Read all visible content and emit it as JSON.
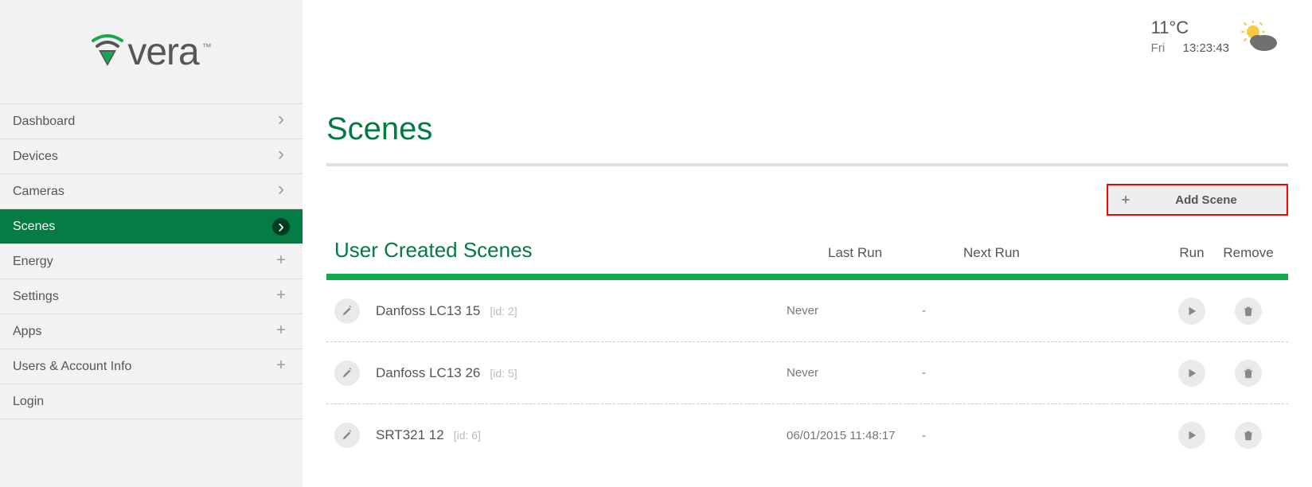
{
  "brand": {
    "name": "vera",
    "tm": "™"
  },
  "sidebar": {
    "items": [
      {
        "label": "Dashboard",
        "kind": "chev",
        "active": false
      },
      {
        "label": "Devices",
        "kind": "chev",
        "active": false
      },
      {
        "label": "Cameras",
        "kind": "chev",
        "active": false
      },
      {
        "label": "Scenes",
        "kind": "chev",
        "active": true
      },
      {
        "label": "Energy",
        "kind": "plus",
        "active": false
      },
      {
        "label": "Settings",
        "kind": "plus",
        "active": false
      },
      {
        "label": "Apps",
        "kind": "plus",
        "active": false
      },
      {
        "label": "Users & Account Info",
        "kind": "plus",
        "active": false
      },
      {
        "label": "Login",
        "kind": "none",
        "active": false
      }
    ]
  },
  "status": {
    "temp": "11°C",
    "day": "Fri",
    "time": "13:23:43"
  },
  "page": {
    "title": "Scenes",
    "add_button": "Add Scene",
    "section_title": "User Created Scenes",
    "columns": {
      "lastrun": "Last Run",
      "nextrun": "Next Run",
      "run": "Run",
      "remove": "Remove"
    },
    "rows": [
      {
        "name": "Danfoss LC13 15",
        "id_label": "[id: 2]",
        "lastrun": "Never",
        "nextrun": "-"
      },
      {
        "name": "Danfoss LC13 26",
        "id_label": "[id: 5]",
        "lastrun": "Never",
        "nextrun": "-"
      },
      {
        "name": "SRT321 12",
        "id_label": "[id: 6]",
        "lastrun": "06/01/2015 11:48:17",
        "nextrun": "-"
      }
    ]
  },
  "colors": {
    "accent": "#037a42",
    "bar": "#13a94d",
    "highlight_border": "#ff0000"
  }
}
